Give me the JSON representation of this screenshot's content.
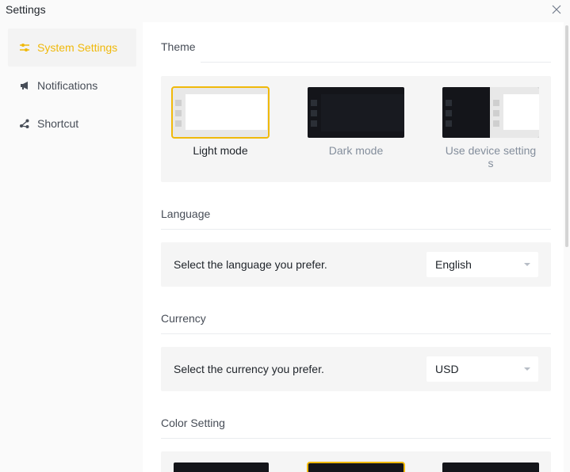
{
  "window": {
    "title": "Settings",
    "close_icon": "close-icon"
  },
  "sidebar": {
    "items": [
      {
        "label": "System Settings",
        "icon": "sliders-icon",
        "active": true
      },
      {
        "label": "Notifications",
        "icon": "megaphone-icon",
        "active": false
      },
      {
        "label": "Shortcut",
        "icon": "share-icon",
        "active": false
      }
    ]
  },
  "sections": {
    "theme": {
      "title": "Theme",
      "options": [
        {
          "label": "Light mode",
          "selected": true
        },
        {
          "label": "Dark mode",
          "selected": false
        },
        {
          "label": "Use device setting",
          "label_wrap": "s",
          "selected": false
        }
      ]
    },
    "language": {
      "title": "Language",
      "prompt": "Select the language you prefer.",
      "value": "English"
    },
    "currency": {
      "title": "Currency",
      "prompt": "Select the currency you prefer.",
      "value": "USD"
    },
    "color_setting": {
      "title": "Color Setting"
    }
  },
  "colors": {
    "accent": "#F0B90B",
    "dark_theme": "#14151a",
    "card_bg": "#F5F5F5"
  }
}
